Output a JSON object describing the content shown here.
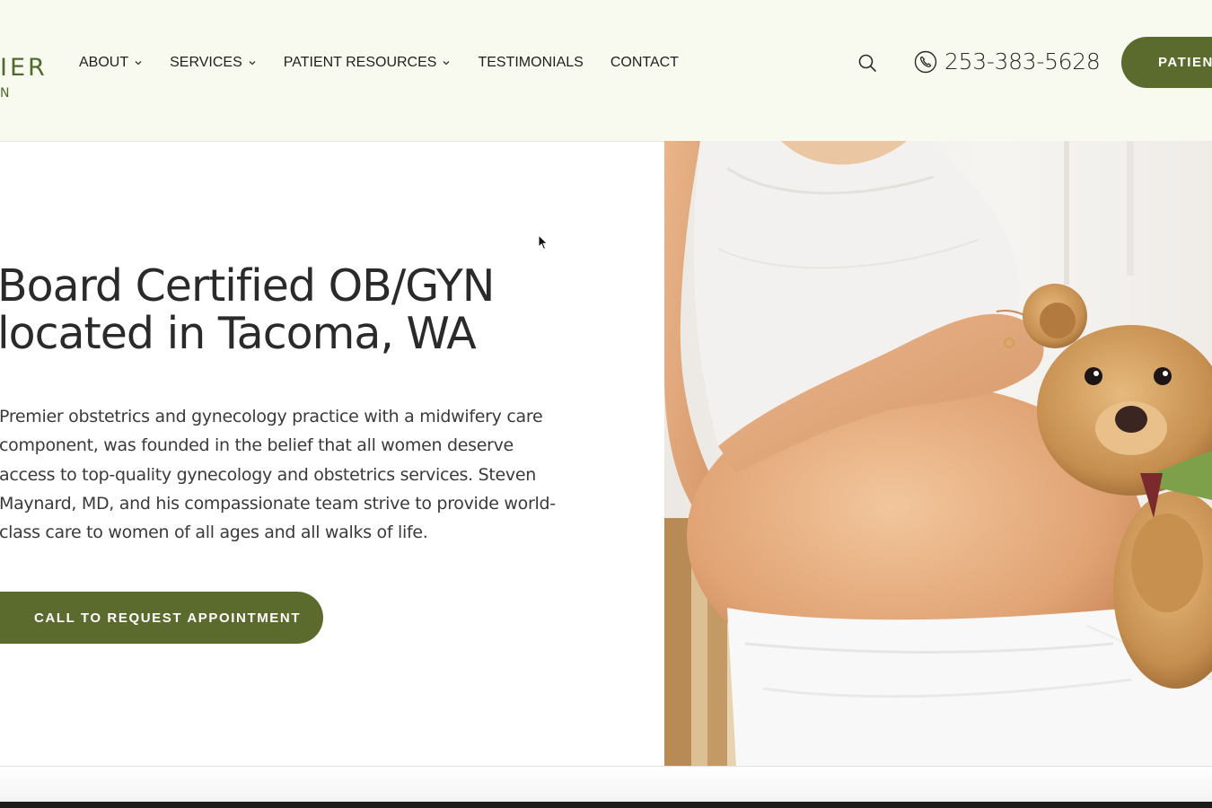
{
  "header": {
    "logo": {
      "line1": "IER",
      "line2": "N"
    },
    "nav": [
      {
        "label": "ABOUT",
        "has_dropdown": true
      },
      {
        "label": "SERVICES",
        "has_dropdown": true
      },
      {
        "label": "PATIENT RESOURCES",
        "has_dropdown": true
      },
      {
        "label": "TESTIMONIALS",
        "has_dropdown": false
      },
      {
        "label": "CONTACT",
        "has_dropdown": false
      }
    ],
    "search_icon": "search-icon",
    "phone": {
      "icon": "phone-icon",
      "number": "253-383-5628"
    },
    "portal_button": "PATIEN"
  },
  "hero": {
    "heading_lines": [
      "Board Certified OB/GYN",
      "located in Tacoma, WA"
    ],
    "paragraph_lines": [
      "Premier obstetrics and gynecology practice with a midwifery care",
      "component, was founded in the belief that all women deserve",
      "access to top-quality gynecology and obstetrics services. Steven",
      "Maynard, MD, and his compassionate team strive to provide world-",
      "class care to women of all ages and all walks of life."
    ],
    "cta_label": "CALL TO REQUEST APPOINTMENT"
  },
  "colors": {
    "accent": "#5b6b2d",
    "header_bg": "#f9faef",
    "logo": "#4f6b2c",
    "text": "#2a2a2a"
  }
}
